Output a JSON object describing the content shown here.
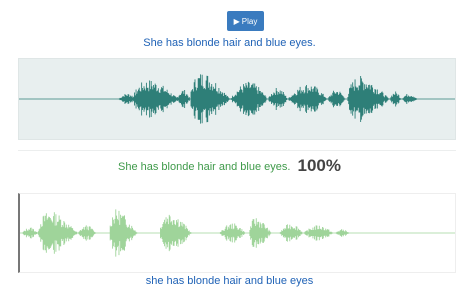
{
  "player": {
    "play_label": "Play",
    "play_icon": "play-icon"
  },
  "reference_sentence": "She has blonde hair and blue eyes.",
  "result": {
    "sentence": "She has blonde hair and blue eyes.",
    "score": "100%"
  },
  "recognized_text": "she has blonde hair and blue eyes",
  "colors": {
    "reference_wave": "#2e7f78",
    "user_wave": "#9fd49a",
    "accent": "#3a7bbf",
    "result_text": "#3f9a4a",
    "link_text": "#1f62b6"
  }
}
